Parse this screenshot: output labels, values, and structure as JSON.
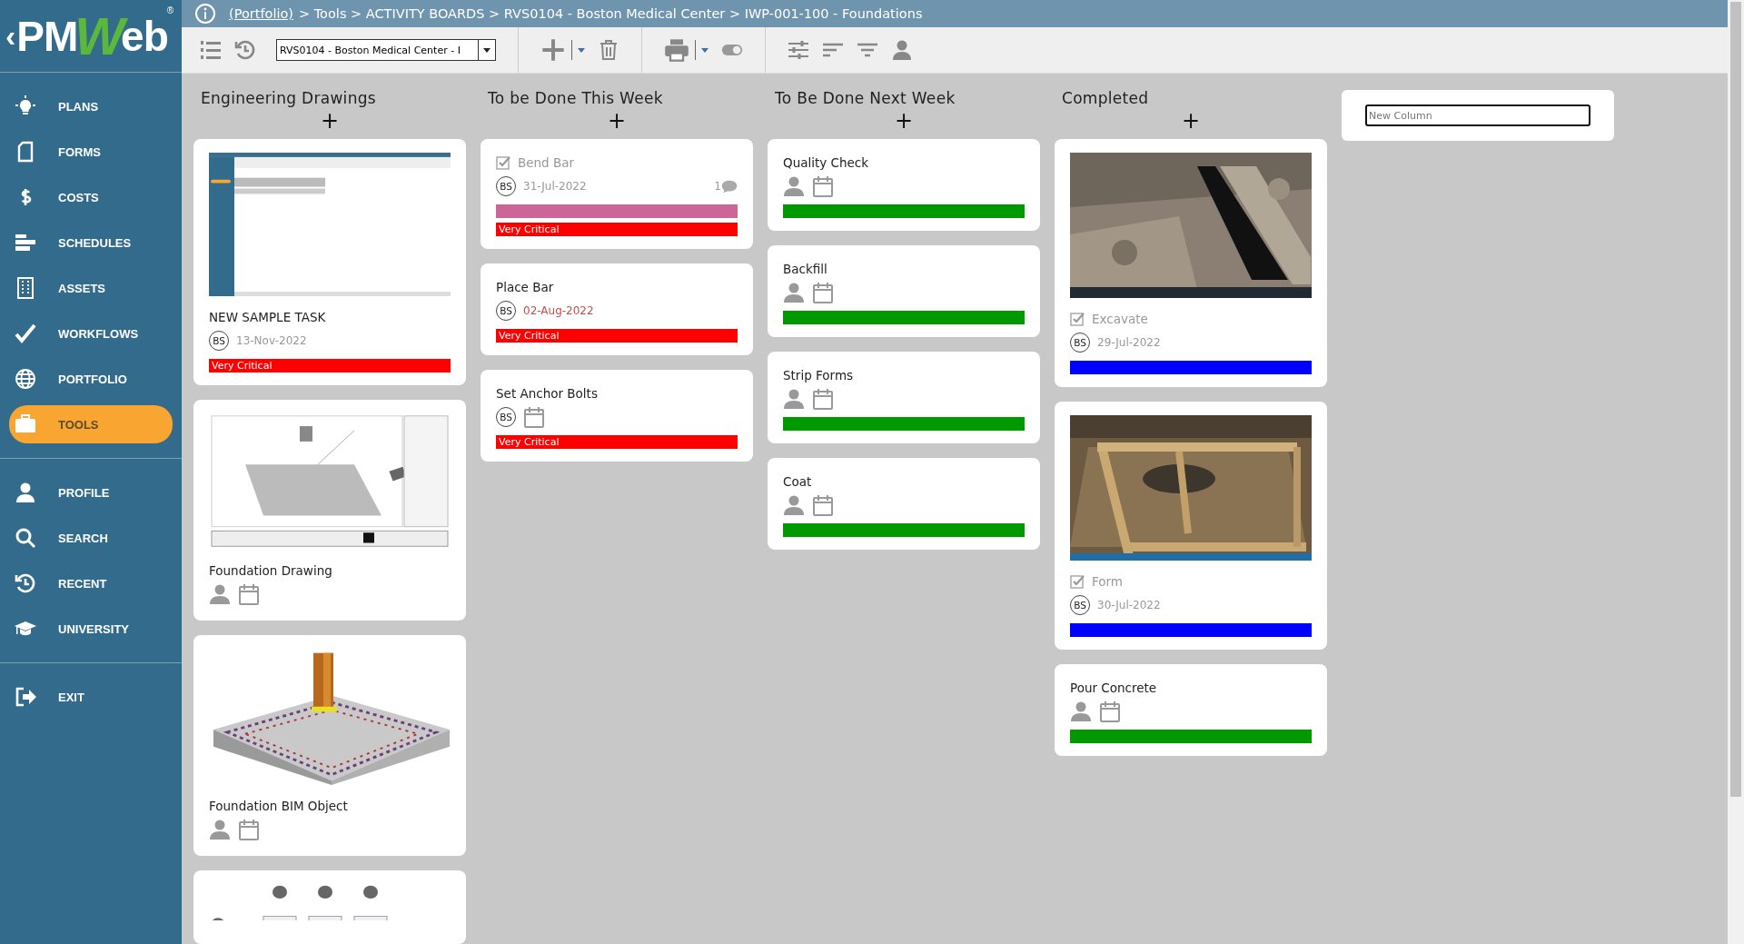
{
  "logo": {
    "back": "‹",
    "parts": [
      {
        "text": "PM",
        "accent": false
      },
      {
        "text": "W",
        "accent": true
      },
      {
        "text": "eb",
        "accent": false
      }
    ],
    "mark": "®"
  },
  "sidebar": {
    "groups": [
      {
        "items": [
          {
            "label": "PLANS",
            "selected": false
          },
          {
            "label": "FORMS",
            "selected": false
          },
          {
            "label": "COSTS",
            "selected": false
          },
          {
            "label": "SCHEDULES",
            "selected": false
          },
          {
            "label": "ASSETS",
            "selected": false
          },
          {
            "label": "WORKFLOWS",
            "selected": false
          },
          {
            "label": "PORTFOLIO",
            "selected": false
          },
          {
            "label": "TOOLS",
            "selected": true
          }
        ]
      },
      {
        "items": [
          {
            "label": "PROFILE",
            "selected": false
          },
          {
            "label": "SEARCH",
            "selected": false
          },
          {
            "label": "RECENT",
            "selected": false
          },
          {
            "label": "UNIVERSITY",
            "selected": false
          }
        ]
      },
      {
        "items": [
          {
            "label": "EXIT",
            "selected": false
          }
        ]
      }
    ]
  },
  "breadcrumb": {
    "link": "(Portfolio)",
    "path": "> Tools > ACTIVITY BOARDS > RVS0104 - Boston Medical Center > IWP-001-100 - Foundations"
  },
  "toolbar": {
    "project_select": "RVS0104 - Boston Medical Center - I"
  },
  "columns": [
    {
      "title": "Engineering Drawings",
      "add": "+",
      "cards": [
        {
          "kind": "picture",
          "title": "NEW SAMPLE TASK",
          "checked": false,
          "assignee": "BS",
          "date": "13-Nov-2022",
          "overdue": false,
          "bars": [
            {
              "color": "#ff0000",
              "label": "Very Critical"
            }
          ]
        },
        {
          "kind": "picture",
          "title": "Foundation Drawing",
          "checked": false
        },
        {
          "kind": "picture",
          "title": "Foundation BIM Object",
          "checked": false
        },
        {
          "kind": "picture"
        }
      ]
    },
    {
      "title": "To be Done This Week",
      "add": "+",
      "cards": [
        {
          "title": "Bend Bar",
          "checked": true,
          "assignee": "BS",
          "date": "31-Jul-2022",
          "overdue": false,
          "comments": "1",
          "bars": [
            {
              "color": "#cc6699"
            },
            {
              "color": "#ff0000",
              "label": "Very Critical"
            }
          ]
        },
        {
          "title": "Place Bar",
          "checked": false,
          "assignee": "BS",
          "date": "02-Aug-2022",
          "overdue": true,
          "bars": [
            {
              "color": "#ff0000",
              "label": "Very Critical"
            }
          ]
        },
        {
          "title": "Set Anchor Bolts",
          "checked": false,
          "assignee": "BS",
          "bars": [
            {
              "color": "#ff0000",
              "label": "Very Critical"
            }
          ]
        }
      ]
    },
    {
      "title": "To Be Done Next Week",
      "add": "+",
      "cards": [
        {
          "title": "Quality Check",
          "checked": false,
          "bars": [
            {
              "color": "#009900"
            }
          ]
        },
        {
          "title": "Backfill",
          "checked": false,
          "bars": [
            {
              "color": "#009900"
            }
          ]
        },
        {
          "title": "Strip Forms",
          "checked": false,
          "bars": [
            {
              "color": "#009900"
            }
          ]
        },
        {
          "title": "Coat",
          "checked": false,
          "bars": [
            {
              "color": "#009900"
            }
          ]
        }
      ]
    },
    {
      "title": "Completed",
      "add": "+",
      "cards": [
        {
          "kind": "picture",
          "title": "Excavate",
          "checked": true,
          "assignee": "BS",
          "date": "29-Jul-2022",
          "overdue": false,
          "bars": [
            {
              "color": "#0000ff"
            }
          ]
        },
        {
          "kind": "picture",
          "title": "Form",
          "checked": true,
          "assignee": "BS",
          "date": "30-Jul-2022",
          "overdue": false,
          "bars": [
            {
              "color": "#0000ff"
            }
          ]
        },
        {
          "title": "Pour Concrete",
          "checked": false,
          "bars": [
            {
              "color": "#009900"
            }
          ]
        }
      ]
    }
  ],
  "new_column": {
    "placeholder": "New Column"
  }
}
